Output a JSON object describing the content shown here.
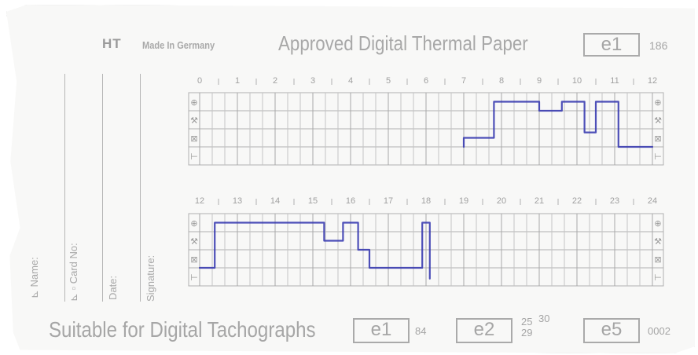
{
  "header": {
    "brand": "HT",
    "made_in": "Made In Germany",
    "approved": "Approved Digital Thermal Paper",
    "approval_mark": "e1",
    "approval_number": "186"
  },
  "side_labels": {
    "name": "Name:",
    "card_no": "Card No:",
    "date": "Date:",
    "signature": "Signature:"
  },
  "footer": {
    "suitable": "Suitable for Digital Tachographs",
    "mark1": "e1",
    "mark1_num": "84",
    "mark2": "e2",
    "mark2_num_a": "25",
    "mark2_num_b": "30",
    "mark2_num_c": "29",
    "mark3": "e5",
    "mark3_num": "0002"
  },
  "chart_grid": {
    "top_hours": [
      "0",
      "1",
      "2",
      "3",
      "4",
      "5",
      "6",
      "7",
      "8",
      "9",
      "10",
      "11",
      "12"
    ],
    "bottom_hours": [
      "12",
      "13",
      "14",
      "15",
      "16",
      "17",
      "18",
      "19",
      "20",
      "21",
      "22",
      "23",
      "24"
    ],
    "row_icons": [
      "⊕",
      "⚒",
      "⊠",
      "⊢"
    ],
    "ink_color": "#3a3cb0"
  },
  "chart_data": {
    "type": "line",
    "description_rows": [
      "driving",
      "work",
      "availability",
      "rest"
    ],
    "top_row_trace": [
      [
        7.0,
        3
      ],
      [
        7.0,
        2.5
      ],
      [
        7.8,
        2.5
      ],
      [
        7.8,
        0.5
      ],
      [
        9.0,
        0.5
      ],
      [
        9.0,
        1.0
      ],
      [
        9.6,
        1.0
      ],
      [
        9.6,
        0.5
      ],
      [
        10.2,
        0.5
      ],
      [
        10.2,
        2.2
      ],
      [
        10.5,
        2.2
      ],
      [
        10.5,
        0.5
      ],
      [
        11.1,
        0.5
      ],
      [
        11.1,
        3
      ],
      [
        12,
        3
      ]
    ],
    "bottom_row_trace": [
      [
        12,
        3
      ],
      [
        12.4,
        3
      ],
      [
        12.4,
        0.5
      ],
      [
        15.3,
        0.5
      ],
      [
        15.3,
        1.5
      ],
      [
        15.8,
        1.5
      ],
      [
        15.8,
        0.5
      ],
      [
        16.2,
        0.5
      ],
      [
        16.2,
        2.0
      ],
      [
        16.5,
        2.0
      ],
      [
        16.5,
        3
      ],
      [
        17.9,
        3
      ],
      [
        17.9,
        0.5
      ],
      [
        18.1,
        0.5
      ],
      [
        18.1,
        3.6
      ]
    ]
  }
}
